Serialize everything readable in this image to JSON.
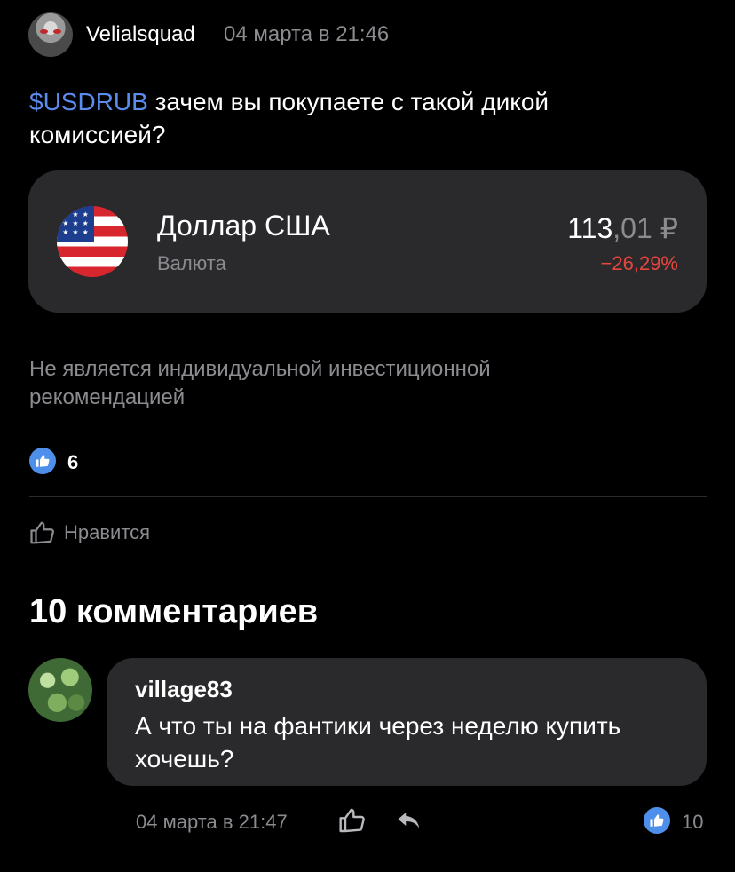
{
  "post": {
    "author": "Velialsquad",
    "time": "04 марта в 21:46",
    "ticker": "$USDRUB",
    "text": " зачем вы покупаете с такой дикой комиссией?"
  },
  "instrument": {
    "name": "Доллар США",
    "type": "Валюта",
    "price_main": "113",
    "price_fraction": ",01 ₽",
    "change": "−26,29%",
    "flag_icon": "us-flag-icon"
  },
  "disclaimer": "Не является индивидуальной инвестиционной рекомендацией",
  "likes": {
    "count": "6"
  },
  "like_button": {
    "label": "Нравится"
  },
  "comments": {
    "title": "10 комментариев",
    "items": [
      {
        "author": "village83",
        "text": "А что ты на фантики через неделю купить хочешь?",
        "time": "04 марта в 21:47",
        "likes": "10"
      }
    ]
  },
  "colors": {
    "background": "#000000",
    "card": "#2a2a2d",
    "ticker": "#5b8def",
    "negative": "#e5463d",
    "secondary_text": "#8b8b90",
    "like_badge": "#4d8fea"
  }
}
